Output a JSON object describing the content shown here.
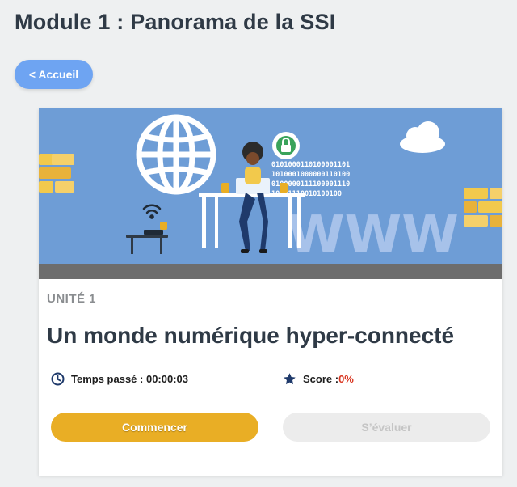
{
  "header": {
    "title": "Module 1 : Panorama de la SSI",
    "back_label": "< Accueil"
  },
  "card": {
    "banner": {
      "binary_lines": [
        "0101000110100001101",
        "1010001000000110100",
        "0100000111100001110",
        "10101110010100100"
      ],
      "www_text": "WWW"
    },
    "unit_label": "UNITÉ 1",
    "unit_title": "Un monde numérique hyper-connecté",
    "time_label": "Temps passé : 00:00:03",
    "score_label": "Score : ",
    "score_value": "0%",
    "start_label": "Commencer",
    "evaluate_label": "S’évaluer"
  },
  "colors": {
    "background": "#eef0f1",
    "back_button": "#6ea4f2",
    "banner_blue": "#6e9dd6",
    "start_button": "#e9ae25",
    "score_red": "#d9341f",
    "title_text": "#2f3a46"
  },
  "icons": {
    "time": "clock-icon",
    "score": "star-icon",
    "banner_globe": "globe-icon",
    "banner_lock": "lock-icon",
    "banner_wifi": "wifi-icon",
    "banner_cloud": "cloud-icon"
  }
}
